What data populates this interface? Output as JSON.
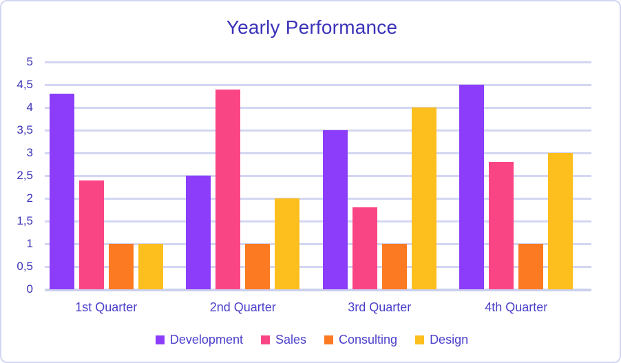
{
  "chart_data": {
    "type": "bar",
    "title": "Yearly Performance",
    "xlabel": "",
    "ylabel": "",
    "categories": [
      "1st Quarter",
      "2nd Quarter",
      "3rd Quarter",
      "4th Quarter"
    ],
    "series": [
      {
        "name": "Development",
        "color": "#8b3dfa",
        "values": [
          4.3,
          2.5,
          3.5,
          4.5
        ]
      },
      {
        "name": "Sales",
        "color": "#fa4585",
        "values": [
          2.4,
          4.4,
          1.8,
          2.8
        ]
      },
      {
        "name": "Consulting",
        "color": "#fb7a22",
        "values": [
          1.0,
          1.0,
          1.0,
          1.0
        ]
      },
      {
        "name": "Design",
        "color": "#fdbf1e",
        "values": [
          1.0,
          2.0,
          4.0,
          3.0
        ]
      }
    ],
    "ylim": [
      0,
      5
    ],
    "ytick_values": [
      5,
      4.5,
      4,
      3.5,
      3,
      2.5,
      2,
      1.5,
      1,
      0.5,
      0
    ],
    "ytick_labels": [
      "5",
      "4,5",
      "4",
      "3,5",
      "3",
      "2,5",
      "2",
      "1,5",
      "1",
      "0,5",
      "0"
    ],
    "grid": true,
    "legend_position": "bottom",
    "decimal_separator": ",",
    "colors": {
      "title": "#3b32b8",
      "axis_text": "#4b3fcb",
      "gridline": "#d3d6f2",
      "border": "#d3d6f2",
      "background": "#ffffff"
    }
  }
}
